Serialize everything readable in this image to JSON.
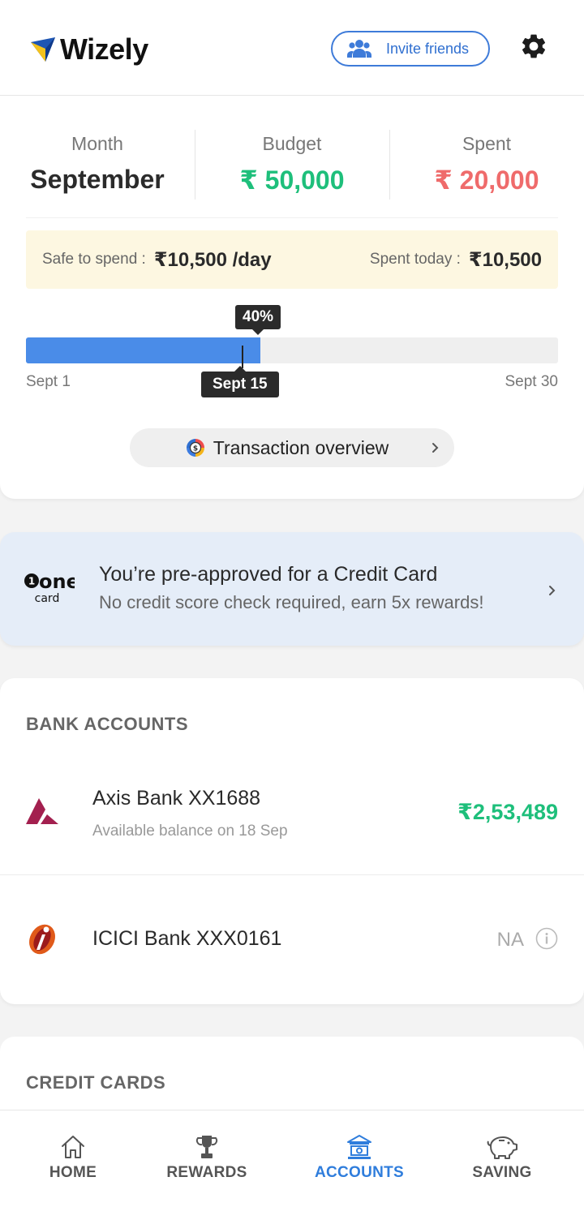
{
  "header": {
    "app_name": "Wizely",
    "invite_label": "Invite friends"
  },
  "summary": {
    "month_label": "Month",
    "month_value": "September",
    "budget_label": "Budget",
    "budget_value": "₹ 50,000",
    "spent_label": "Spent",
    "spent_value": "₹ 20,000",
    "safe_label": "Safe to spend :",
    "safe_value": "₹10,500 /day",
    "today_label": "Spent today :",
    "today_value": "₹10,500",
    "progress_text": "40%",
    "progress_fraction": 0.44,
    "today_marker": "Sept 15",
    "axis_start": "Sept 1",
    "axis_end": "Sept 30",
    "overview_label": "Transaction overview"
  },
  "promo": {
    "logo_word": "one",
    "logo_sub": "card",
    "title": "You’re pre-approved for a Credit Card",
    "subtitle": "No credit score check required, earn 5x rewards!"
  },
  "bank_accounts": {
    "title": "BANK ACCOUNTS",
    "items": [
      {
        "name": "Axis Bank XX1688",
        "subtitle": "Available balance on 18 Sep",
        "amount": "₹2,53,489"
      },
      {
        "name": "ICICI Bank XXX0161",
        "amount": "NA"
      }
    ]
  },
  "credit_cards": {
    "title": "CREDIT CARDS"
  },
  "nav": {
    "items": [
      {
        "label": "HOME",
        "icon": "home-icon"
      },
      {
        "label": "REWARDS",
        "icon": "trophy-icon"
      },
      {
        "label": "ACCOUNTS",
        "icon": "bank-icon",
        "active": true
      },
      {
        "label": "SAVING",
        "icon": "piggy-bank-icon"
      }
    ]
  },
  "colors": {
    "accent": "#2f7ddc",
    "positive": "#1ebf7b",
    "negative": "#ef6b6b",
    "progress": "#4a8ce8"
  }
}
